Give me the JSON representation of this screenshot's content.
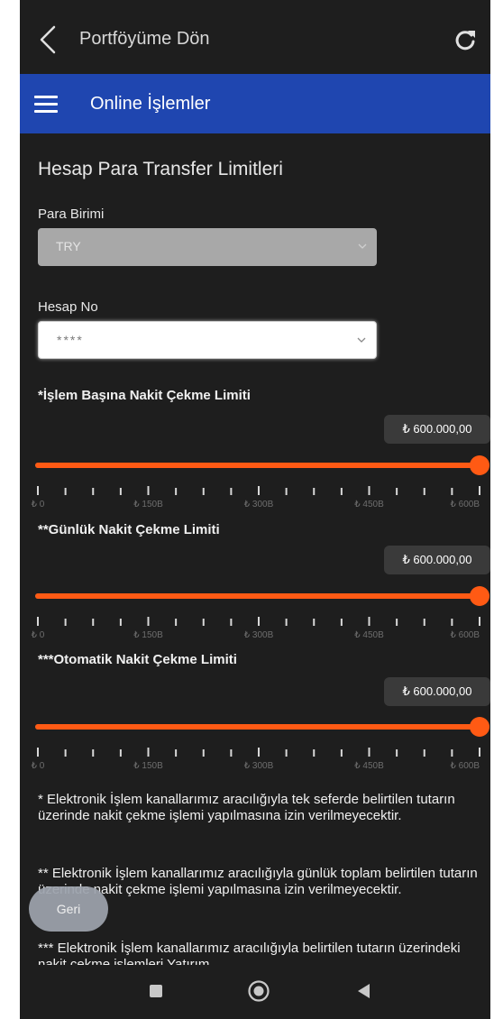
{
  "header": {
    "back_label": "Portföyüme Dön",
    "icons": {
      "back": "chevron-left-icon",
      "refresh": "refresh-icon"
    }
  },
  "navbar": {
    "title": "Online İşlemler",
    "menu_icon": "hamburger-menu-icon",
    "color": "#1f46b0"
  },
  "page": {
    "title": "Hesap Para Transfer Limitleri",
    "currency": {
      "label": "Para Birimi",
      "value": "TRY"
    },
    "account": {
      "label": "Hesap No",
      "value": "****"
    }
  },
  "limits": [
    {
      "label": "*İşlem Başına Nakit Çekme Limiti",
      "value": "₺ 600.000,00",
      "fraction": 1.0,
      "ticks": [
        "₺ 0",
        "₺ 150B",
        "₺ 300B",
        "₺ 450B",
        "₺ 600B"
      ]
    },
    {
      "label": "**Günlük Nakit Çekme Limiti",
      "value": "₺ 600.000,00",
      "fraction": 1.0,
      "ticks": [
        "₺ 0",
        "₺ 150B",
        "₺ 300B",
        "₺ 450B",
        "₺ 600B"
      ]
    },
    {
      "label": "***Otomatik Nakit Çekme Limiti",
      "value": "₺ 600.000,00",
      "fraction": 1.0,
      "ticks": [
        "₺ 0",
        "₺ 150B",
        "₺ 300B",
        "₺ 450B",
        "₺ 600B"
      ]
    }
  ],
  "accent_color": "#ff5a14",
  "notes": [
    "* Elektronik İşlem kanallarımız aracılığıyla tek seferde belirtilen tutarın üzerinde nakit çekme işlemi yapılmasına izin verilmeyecektir.",
    "** Elektronik İşlem kanallarımız aracılığıyla günlük toplam belirtilen tutarın üzerinde nakit çekme işlemi yapılmasına izin verilmeyecektir.",
    "*** Elektronik İşlem kanallarımız aracılığıyla belirtilen tutarın üzerindeki nakit çekme işlemleri Yatırım"
  ],
  "fab": {
    "label": "Geri"
  },
  "system_nav": {
    "recent": "recent-apps-icon",
    "home": "home-icon",
    "back": "back-triangle-icon"
  }
}
